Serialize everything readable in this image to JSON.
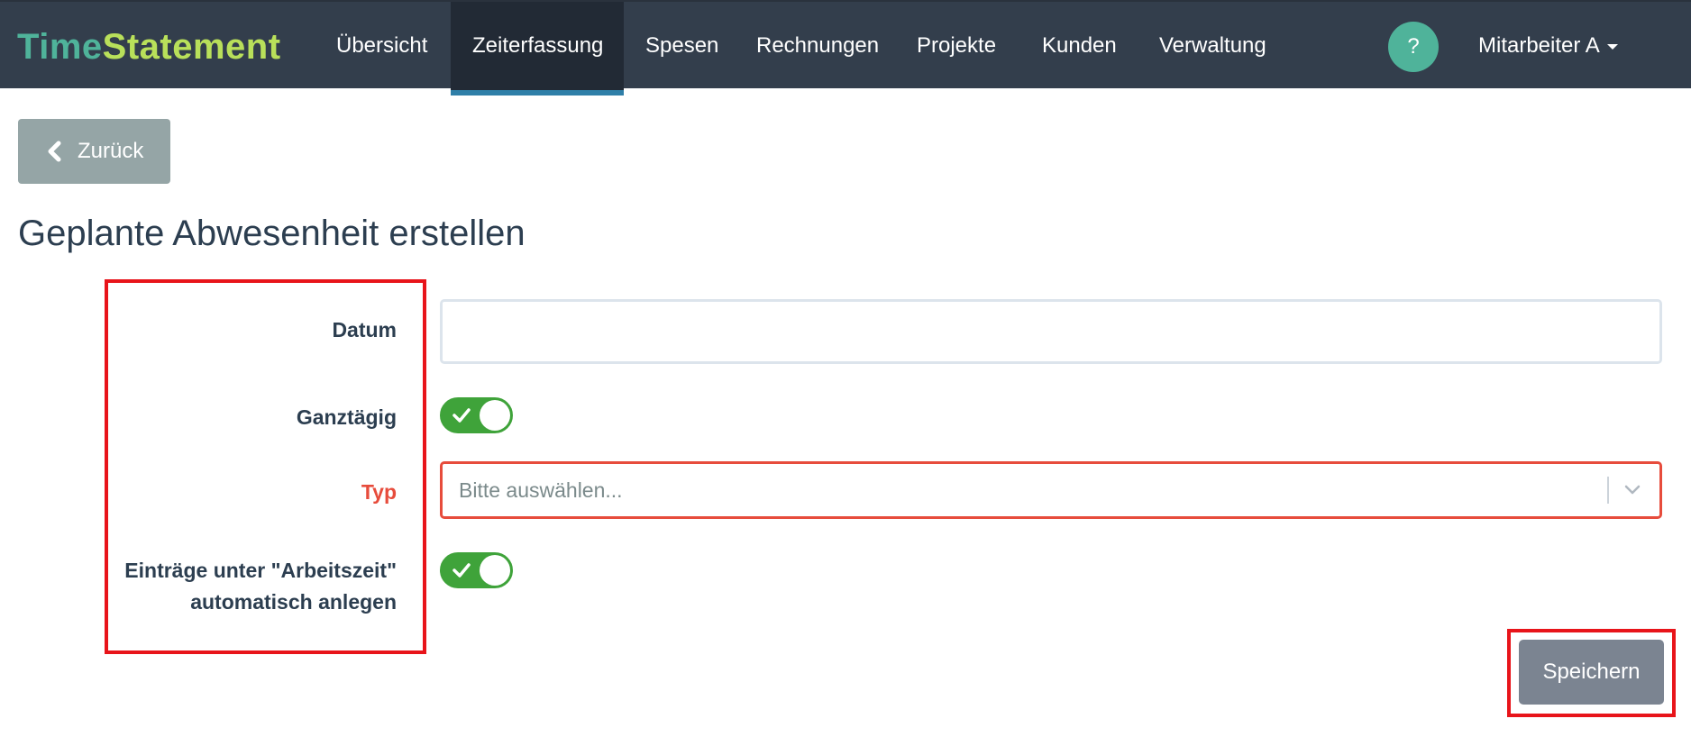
{
  "app": {
    "brand_part1": "Time",
    "brand_part2": "Statement",
    "colors": {
      "navbar": "#333e4c",
      "brand_primary": "#4fb39a",
      "brand_accent": "#b9e05a",
      "toggle_on": "#3fa33a",
      "error": "#e74c3c"
    }
  },
  "nav": {
    "items": [
      {
        "label": "Übersicht"
      },
      {
        "label": "Zeiterfassung",
        "active": true
      },
      {
        "label": "Spesen"
      },
      {
        "label": "Rechnungen"
      },
      {
        "label": "Projekte"
      },
      {
        "label": "Kunden"
      },
      {
        "label": "Verwaltung"
      }
    ],
    "help_label": "?",
    "user_label": "Mitarbeiter A"
  },
  "back_button": {
    "label": "Zurück",
    "icon": "chevron-left-icon"
  },
  "page": {
    "title": "Geplante Abwesenheit erstellen"
  },
  "form": {
    "datum": {
      "label": "Datum",
      "value": ""
    },
    "ganztaegig": {
      "label": "Ganztägig",
      "checked": true
    },
    "typ": {
      "label": "Typ",
      "placeholder": "Bitte auswählen...",
      "required_error": true
    },
    "arbeitszeit": {
      "label_line1": "Einträge unter \"Arbeitszeit\"",
      "label_line2": "automatisch anlegen",
      "checked": true
    }
  },
  "actions": {
    "save_label": "Speichern"
  }
}
